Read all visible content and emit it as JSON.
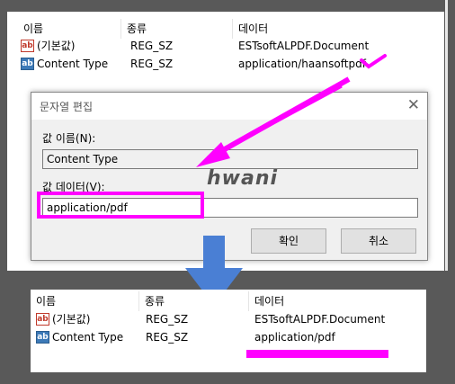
{
  "top_panel": {
    "columns": {
      "name": "이름",
      "type": "종류",
      "data": "데이터"
    },
    "rows": [
      {
        "name": "(기본값)",
        "type": "REG_SZ",
        "data": "ESTsoftALPDF.Document"
      },
      {
        "name": "Content Type",
        "type": "REG_SZ",
        "data": "application/haansoftpdf"
      }
    ]
  },
  "dialog": {
    "title": "문자열 편집",
    "value_name_label": "값 이름(N):",
    "value_name": "Content Type",
    "value_data_label": "값 데이터(V):",
    "value_data": "application/pdf",
    "ok_label": "확인",
    "cancel_label": "취소"
  },
  "watermark": "hwani",
  "bottom_panel": {
    "columns": {
      "name": "이름",
      "type": "종류",
      "data": "데이터"
    },
    "rows": [
      {
        "name": "(기본값)",
        "type": "REG_SZ",
        "data": "ESTsoftALPDF.Document"
      },
      {
        "name": "Content Type",
        "type": "REG_SZ",
        "data": "application/pdf"
      }
    ]
  },
  "colors": {
    "highlight": "#ff00ff",
    "arrow": "#4a7fd4",
    "background": "#595959"
  },
  "icons": {
    "string_value": "ab-string-icon",
    "close": "close-icon"
  }
}
